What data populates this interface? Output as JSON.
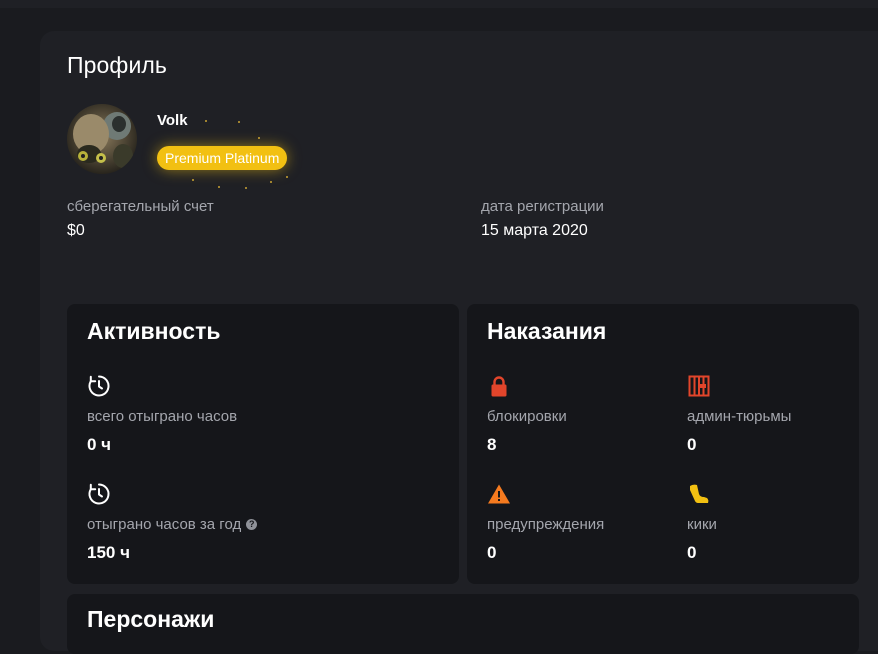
{
  "page": {
    "title": "Профиль"
  },
  "user": {
    "name": "Volk",
    "badge": "Premium Platinum",
    "badge_color": "#f2c012"
  },
  "fields": {
    "savings": {
      "label": "сберегательный счет",
      "value": "$0"
    },
    "registration": {
      "label": "дата регистрации",
      "value": "15 марта 2020"
    }
  },
  "activity": {
    "title": "Активность",
    "stats": [
      {
        "icon": "clock-icon",
        "label": "всего отыграно часов",
        "value": "0 ч"
      },
      {
        "icon": "clock-icon",
        "label": "отыграно часов за год",
        "value": "150 ч",
        "help_icon": "question-icon"
      }
    ]
  },
  "punishments": {
    "title": "Наказания",
    "stats": [
      {
        "icon": "lock-icon",
        "label": "блокировки",
        "value": "8",
        "color": "#e2452b"
      },
      {
        "icon": "jail-icon",
        "label": "админ-тюрьмы",
        "value": "0",
        "color": "#e2452b"
      },
      {
        "icon": "warning-icon",
        "label": "предупреждения",
        "value": "0",
        "color": "#f57a1f"
      },
      {
        "icon": "boot-icon",
        "label": "кики",
        "value": "0",
        "color": "#f2c012"
      }
    ]
  },
  "characters": {
    "title": "Персонажи"
  }
}
